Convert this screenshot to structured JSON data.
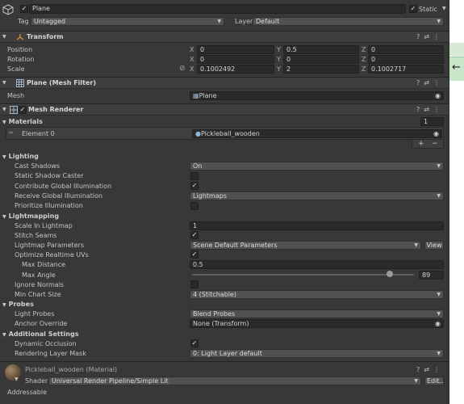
{
  "object": {
    "name": "Plane",
    "static_label": "Static",
    "tag_label": "Tag",
    "tag_value": "Untagged",
    "layer_label": "Layer",
    "layer_value": "Default"
  },
  "transform": {
    "title": "Transform",
    "position": {
      "label": "Position",
      "x": "0",
      "y": "0.5",
      "z": "0"
    },
    "rotation": {
      "label": "Rotation",
      "x": "0",
      "y": "0",
      "z": "0"
    },
    "scale": {
      "label": "Scale",
      "x": "0.1002492",
      "y": "2",
      "z": "0.1002717"
    },
    "axes": {
      "x": "X",
      "y": "Y",
      "z": "Z"
    }
  },
  "mesh_filter": {
    "title": "Plane (Mesh Filter)",
    "mesh_label": "Mesh",
    "mesh_value": "Plane"
  },
  "mesh_renderer": {
    "title": "Mesh Renderer",
    "materials": {
      "label": "Materials",
      "count": "1",
      "element_label": "Element 0",
      "element_value": "Pickleball_wooden",
      "add": "+",
      "remove": "−"
    },
    "lighting": {
      "label": "Lighting",
      "cast_shadows": {
        "label": "Cast Shadows",
        "value": "On"
      },
      "static_shadow_caster": {
        "label": "Static Shadow Caster",
        "checked": false
      },
      "contribute_gi": {
        "label": "Contribute Global Illumination",
        "checked": true
      },
      "receive_gi": {
        "label": "Receive Global Illumination",
        "value": "Lightmaps"
      },
      "prioritize": {
        "label": "Prioritize Illumination",
        "checked": false
      }
    },
    "lightmapping": {
      "label": "Lightmapping",
      "scale": {
        "label": "Scale In Lightmap",
        "value": "1"
      },
      "stitch": {
        "label": "Stitch Seams",
        "checked": true
      },
      "params": {
        "label": "Lightmap Parameters",
        "value": "Scene Default Parameters",
        "button": "View"
      },
      "optimize": {
        "label": "Optimize Realtime UVs",
        "checked": true
      },
      "max_distance": {
        "label": "Max Distance",
        "value": "0.5"
      },
      "max_angle": {
        "label": "Max Angle",
        "value": "89",
        "slider_fraction": 0.89
      },
      "ignore_normals": {
        "label": "Ignore Normals",
        "checked": false
      },
      "min_chart": {
        "label": "Min Chart Size",
        "value": "4 (Stitchable)"
      }
    },
    "probes": {
      "label": "Probes",
      "light_probes": {
        "label": "Light Probes",
        "value": "Blend Probes"
      },
      "anchor": {
        "label": "Anchor Override",
        "value": "None (Transform)"
      }
    },
    "additional": {
      "label": "Additional Settings",
      "dynamic_occlusion": {
        "label": "Dynamic Occlusion",
        "checked": true
      },
      "layer_mask": {
        "label": "Rendering Layer Mask",
        "value": "0: Light Layer default"
      }
    }
  },
  "material": {
    "title": "Pickleball_wooden (Material)",
    "shader_label": "Shader",
    "shader_value": "Universal Render Pipeline/Simple Lit",
    "edit_button": "Edit..."
  },
  "footer": {
    "addressable": "Addressable"
  },
  "colors": {
    "background": "#383838",
    "field": "#2a2a2a",
    "accent": "#4a90d9",
    "gutter_green": "#c8e6c9"
  }
}
